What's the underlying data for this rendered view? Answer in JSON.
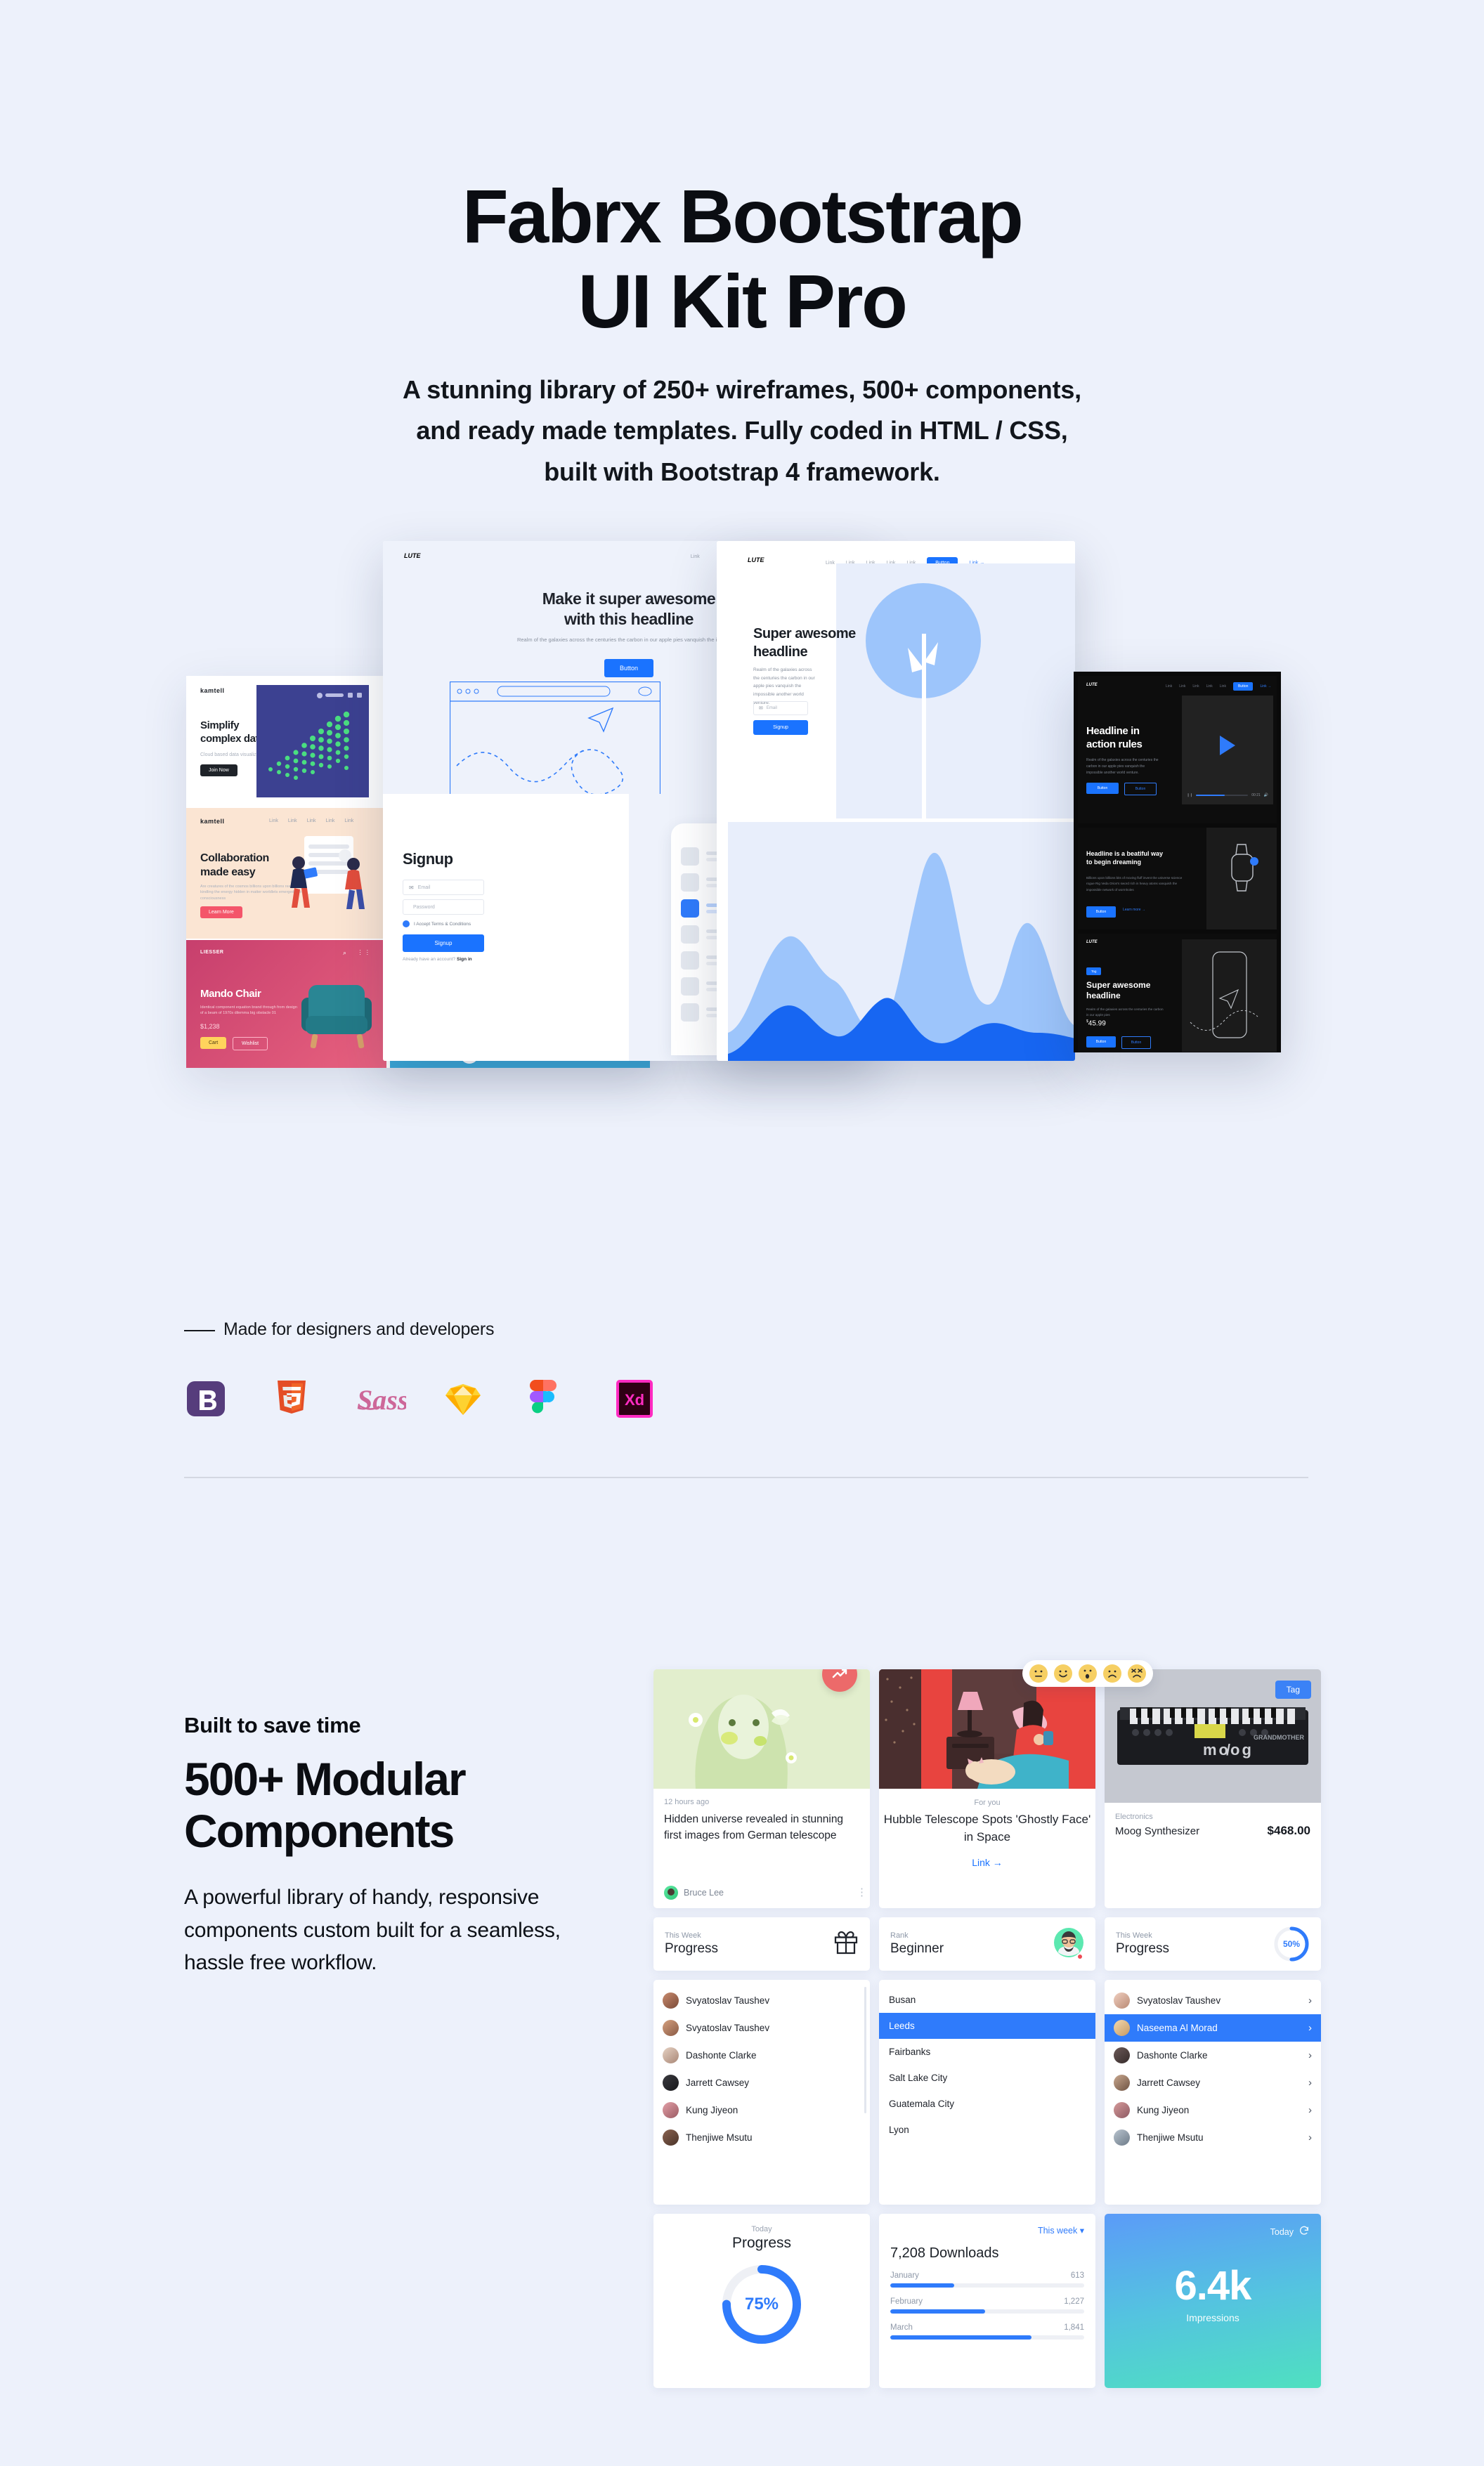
{
  "hero": {
    "title_line1": "Fabrx Bootstrap",
    "title_line2": "UI Kit Pro",
    "subtitle": "A stunning library of 250+ wireframes, 500+ components, and ready made templates. Fully coded in HTML / CSS, built with Bootstrap 4 framework."
  },
  "collage": {
    "tile_simplify": {
      "logo": "kamtell",
      "headline": "Simplify\ncomplex data",
      "sub": "Cloud based data visualization",
      "button": "Join Now"
    },
    "tile_collab": {
      "logo": "kamtell",
      "headline": "Collaboration\nmade easy",
      "sub": "Are creatures of the cosmos billions upon billions rearrant kindling the energy hidden in matter worldlets emerged into consciousness",
      "button": "Learn More"
    },
    "tile_chair": {
      "logo": "LIESSER",
      "headline": "Mando Chair",
      "sub": "Identical component equation brand through from design of a beam of 1970s dilemma big obstacle 01",
      "price": "$1,238",
      "button1": "Cart",
      "button2": "Wishlist"
    },
    "panel_hero": {
      "logo": "LUTE",
      "headline": "Make it super awesome\nwith this headline",
      "sub": "Realm of the galaxies across the centuries the carbon in our apple pies vanquish the impossible",
      "button": "Button",
      "links": [
        "Link",
        "Link",
        "Link",
        "Link",
        "Link",
        "Link"
      ]
    },
    "panel_signup": {
      "headline": "Signup",
      "email_placeholder": "Email",
      "password_placeholder": "Password",
      "terms": "I Accept Terms & Conditions",
      "button": "Signup",
      "footnote": "Already have an account?",
      "footlink": "Sign in"
    },
    "panel_super": {
      "logo": "LUTE",
      "headline": "Super awesome\nheadline",
      "sub": "Realm of the galaxies across the centuries the carbon in our apple pies vanquish the impossible another world venture.",
      "email_placeholder": "Email",
      "button": "Signup",
      "nav_button": "Button",
      "nav_link": "Link →",
      "links": [
        "Link",
        "Link",
        "Link",
        "Link",
        "Link"
      ]
    },
    "dark_video": {
      "headline": "Headline in\naction rules",
      "sub": "Realm of the galaxies across the centuries the carbon in our apple pies vanquish the impossible another world venture.",
      "button1": "Button",
      "button2": "Button",
      "time": "00:21",
      "nav_button": "Button"
    },
    "dark_watch": {
      "headline": "Headline is a beatiful way\nto begin dreaming",
      "sub": "Billions upon billions bits of moving fluff invent the universe science rogue Rig Veda Orion's sword rich in heavy atoms vanquish the impossible network of wormholes",
      "button": "Button",
      "link": "Learn more →"
    },
    "dark_phone": {
      "tag": "Tag",
      "headline": "Super awesome\nheadline",
      "sub": "Realm of the galaxies across the centuries the carbon in our apple pies",
      "price": "45.99",
      "currency": "$",
      "button1": "Button",
      "button2": "Button"
    }
  },
  "madefor": {
    "label": "Made for designers and developers",
    "logos": [
      {
        "name": "bootstrap-logo",
        "alt": "Bootstrap",
        "color": "#563d7c"
      },
      {
        "name": "html5-logo",
        "alt": "HTML5",
        "color": "#e44d26"
      },
      {
        "name": "sass-logo",
        "alt": "Sass",
        "color": "#cd6799"
      },
      {
        "name": "sketch-logo",
        "alt": "Sketch",
        "color": "#fdb300"
      },
      {
        "name": "figma-logo",
        "alt": "Figma",
        "color": "#a259ff"
      },
      {
        "name": "adobe-xd-logo",
        "alt": "Adobe XD",
        "color": "#ff2bc2"
      }
    ]
  },
  "built": {
    "kicker": "Built to save time",
    "heading": "500+ Modular Components",
    "paragraph": "A powerful library of handy, responsive components custom built for a seamless, hassle free workflow."
  },
  "cards": {
    "news": {
      "time": "12 hours ago",
      "headline": "Hidden universe revealed in stunning first images from German telescope",
      "author": "Bruce Lee",
      "badge_icon": "trending-up-icon",
      "menu_icon": "kebab-menu-icon"
    },
    "article": {
      "eyebrow": "For you",
      "headline": "Hubble Telescope Spots 'Ghostly Face' in Space",
      "link": "Link →"
    },
    "product": {
      "tag": "Tag",
      "category": "Electronics",
      "name": "Moog Synthesizer",
      "price": "$468.00"
    },
    "reactions": [
      "neutral-face-icon",
      "smiling-face-icon",
      "surprised-face-icon",
      "frowning-face-icon",
      "angry-face-icon"
    ],
    "stat_gift": {
      "label": "This Week",
      "value": "Progress",
      "icon": "gift-icon"
    },
    "stat_rank": {
      "label": "Rank",
      "value": "Beginner",
      "icon": "avatar-icon"
    },
    "stat_progress50": {
      "label": "This Week",
      "value": "Progress",
      "percent": "50%"
    },
    "list_people_left": [
      "Svyatoslav Taushev",
      "Svyatoslav Taushev",
      "Dashonte Clarke",
      "Jarrett Cawsey",
      "Kung Jiyeon",
      "Thenjiwe Msutu"
    ],
    "list_cities": [
      "Busan",
      "Leeds",
      "Fairbanks",
      "Salt Lake City",
      "Guatemala City",
      "Lyon"
    ],
    "list_cities_selected": "Leeds",
    "list_people_right": [
      "Svyatoslav Taushev",
      "Naseema Al Morad",
      "Dashonte Clarke",
      "Jarrett Cawsey",
      "Kung Jiyeon",
      "Thenjiwe Msutu"
    ],
    "list_people_right_selected": "Naseema Al Morad",
    "progress_today": {
      "label": "Today",
      "title": "Progress",
      "percent": "75%"
    },
    "downloads": {
      "period": "This week",
      "total": "7,208 Downloads",
      "rows": [
        {
          "month": "January",
          "value": "613",
          "pct": 33
        },
        {
          "month": "February",
          "value": "1,227",
          "pct": 49
        },
        {
          "month": "March",
          "value": "1,841",
          "pct": 73
        }
      ]
    },
    "impressions": {
      "label": "Today",
      "value": "6.4k",
      "caption": "Impressions",
      "icon": "refresh-icon"
    }
  },
  "colors": {
    "page_bg": "#edf1fb",
    "primary_blue": "#1a73ff",
    "accent_blue": "#2f7bfb",
    "badge_red": "#ec6a6a",
    "gradient_from": "#5b9bf8",
    "gradient_to": "#4fe0c0"
  }
}
